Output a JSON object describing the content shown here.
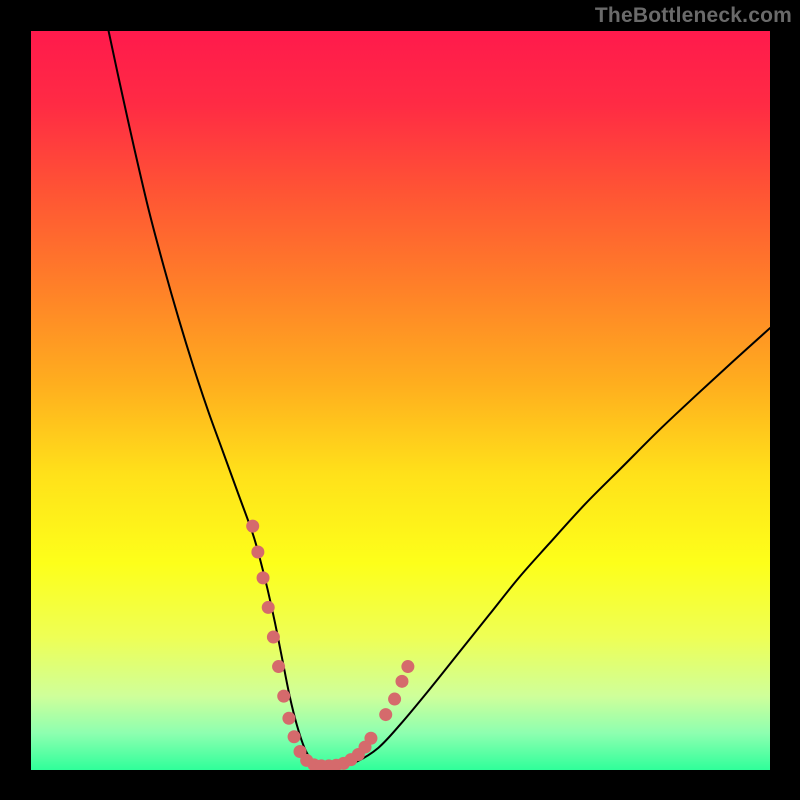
{
  "watermark": "TheBottleneck.com",
  "colors": {
    "black": "#000000",
    "curve": "#000000",
    "dot": "#d56a6c"
  },
  "chart_data": {
    "type": "line",
    "title": "",
    "xlabel": "",
    "ylabel": "",
    "xlim": [
      0,
      100
    ],
    "ylim": [
      0,
      100
    ],
    "background_gradient": {
      "stops": [
        {
          "offset": 0.0,
          "color": "#ff1a4c"
        },
        {
          "offset": 0.1,
          "color": "#ff2b44"
        },
        {
          "offset": 0.22,
          "color": "#ff5534"
        },
        {
          "offset": 0.35,
          "color": "#ff8128"
        },
        {
          "offset": 0.48,
          "color": "#ffaf1e"
        },
        {
          "offset": 0.6,
          "color": "#ffe11a"
        },
        {
          "offset": 0.72,
          "color": "#fdff1a"
        },
        {
          "offset": 0.82,
          "color": "#eeff55"
        },
        {
          "offset": 0.9,
          "color": "#cfff9a"
        },
        {
          "offset": 0.95,
          "color": "#8effb0"
        },
        {
          "offset": 1.0,
          "color": "#2fff9a"
        }
      ]
    },
    "series": [
      {
        "name": "bottleneck-curve",
        "x": [
          10.5,
          12,
          14,
          16,
          18,
          20,
          22,
          24,
          26,
          28,
          30,
          31,
          32,
          33,
          34,
          35,
          36,
          37,
          38,
          39,
          40,
          42,
          44,
          47,
          50,
          54,
          58,
          62,
          66,
          70,
          75,
          80,
          85,
          90,
          95,
          100
        ],
        "y": [
          100,
          93,
          84,
          75.5,
          68,
          61,
          54.5,
          48.5,
          43,
          37.5,
          32,
          28.5,
          24.5,
          20,
          15,
          10,
          6,
          3,
          1.3,
          0.6,
          0.5,
          0.6,
          1.1,
          3,
          6.2,
          11,
          16,
          21,
          26,
          30.5,
          36,
          41,
          46,
          50.7,
          55.3,
          59.8
        ]
      }
    ],
    "dots": [
      {
        "x": 30.0,
        "y": 33.0
      },
      {
        "x": 30.7,
        "y": 29.5
      },
      {
        "x": 31.4,
        "y": 26.0
      },
      {
        "x": 32.1,
        "y": 22.0
      },
      {
        "x": 32.8,
        "y": 18.0
      },
      {
        "x": 33.5,
        "y": 14.0
      },
      {
        "x": 34.2,
        "y": 10.0
      },
      {
        "x": 34.9,
        "y": 7.0
      },
      {
        "x": 35.6,
        "y": 4.5
      },
      {
        "x": 36.4,
        "y": 2.5
      },
      {
        "x": 37.3,
        "y": 1.3
      },
      {
        "x": 38.3,
        "y": 0.7
      },
      {
        "x": 39.3,
        "y": 0.55
      },
      {
        "x": 40.3,
        "y": 0.55
      },
      {
        "x": 41.3,
        "y": 0.65
      },
      {
        "x": 42.3,
        "y": 0.9
      },
      {
        "x": 43.3,
        "y": 1.4
      },
      {
        "x": 44.3,
        "y": 2.1
      },
      {
        "x": 45.2,
        "y": 3.1
      },
      {
        "x": 46.0,
        "y": 4.3
      },
      {
        "x": 48.0,
        "y": 7.5
      },
      {
        "x": 49.2,
        "y": 9.6
      },
      {
        "x": 50.2,
        "y": 12.0
      },
      {
        "x": 51.0,
        "y": 14.0
      }
    ]
  }
}
